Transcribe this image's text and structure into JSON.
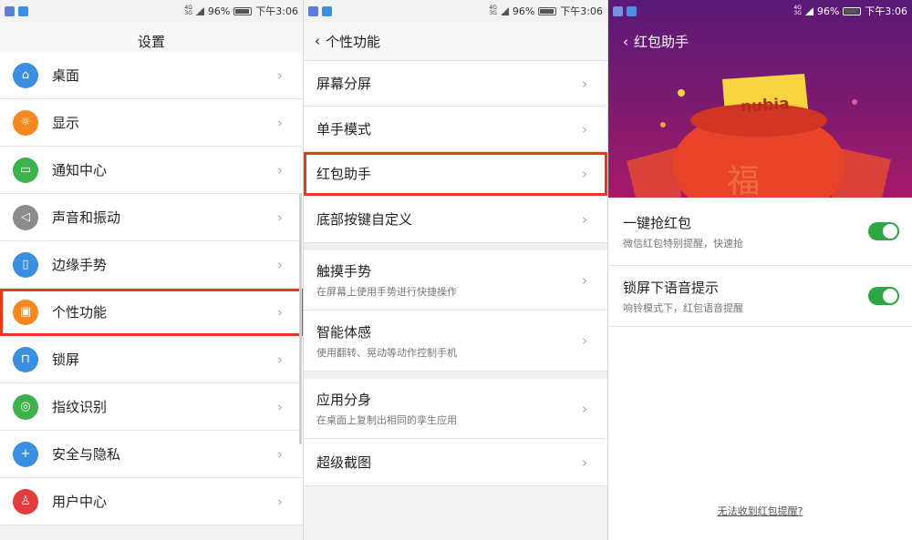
{
  "status": {
    "net_top": "4G",
    "net_bottom": "3G",
    "battery": "96%",
    "time": "下午3:06"
  },
  "s1": {
    "title": "设置",
    "items": [
      {
        "label": "桌面",
        "icon": "home-icon",
        "color": "#3a8fe0",
        "glyph": "⌂"
      },
      {
        "label": "显示",
        "icon": "sun-icon",
        "color": "#f5891f",
        "glyph": "☼"
      },
      {
        "label": "通知中心",
        "icon": "chat-icon",
        "color": "#3cb34a",
        "glyph": "▭"
      },
      {
        "label": "声音和振动",
        "icon": "speaker-icon",
        "color": "#8c8c8c",
        "glyph": "◁"
      },
      {
        "label": "边缘手势",
        "icon": "edge-icon",
        "color": "#3a8fe0",
        "glyph": "▯"
      },
      {
        "label": "个性功能",
        "icon": "calendar-icon",
        "color": "#f5891f",
        "glyph": "▣"
      },
      {
        "label": "锁屏",
        "icon": "lock-icon",
        "color": "#3a8fe0",
        "glyph": "⊓"
      },
      {
        "label": "指纹识别",
        "icon": "fingerprint-icon",
        "color": "#3cb34a",
        "glyph": "◎"
      },
      {
        "label": "安全与隐私",
        "icon": "shield-icon",
        "color": "#3a8fe0",
        "glyph": "+"
      },
      {
        "label": "用户中心",
        "icon": "user-icon",
        "color": "#e43b3b",
        "glyph": "♙"
      }
    ]
  },
  "s2": {
    "title": "个性功能",
    "items": [
      {
        "label": "屏幕分屏",
        "sub": ""
      },
      {
        "label": "单手模式",
        "sub": ""
      },
      {
        "label": "红包助手",
        "sub": ""
      },
      {
        "label": "底部按键自定义",
        "sub": ""
      },
      {
        "label": "触摸手势",
        "sub": "在屏幕上使用手势进行快捷操作"
      },
      {
        "label": "智能体感",
        "sub": "使用翻转、晃动等动作控制手机"
      },
      {
        "label": "应用分身",
        "sub": "在桌面上复制出相同的孪生应用"
      },
      {
        "label": "超级截图",
        "sub": ""
      }
    ]
  },
  "s3": {
    "title": "红包助手",
    "brand": "nubia",
    "bag_text": "福",
    "items": [
      {
        "label": "一键抢红包",
        "sub": "微信红包特别提醒，快速抢",
        "on": true
      },
      {
        "label": "锁屏下语音提示",
        "sub": "响铃模式下，红包语音提醒",
        "on": true
      }
    ],
    "link": "无法收到红包提醒?"
  }
}
